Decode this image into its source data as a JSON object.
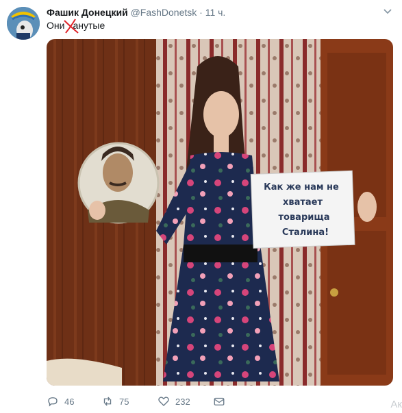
{
  "tweet": {
    "name": "Фашик Донецкий",
    "handle": "@FashDonetsk",
    "time": "· 11 ч.",
    "text": "Они",
    "text_rest": "анутые",
    "photo": {
      "sign_lines": [
        "Как же нам не",
        "хватает",
        "товарища",
        "Сталина!"
      ]
    },
    "actions": {
      "replies": "46",
      "retweets": "75",
      "likes": "232"
    },
    "truncated_right": "Ак"
  },
  "colors": {
    "muted": "#657786",
    "strike": "#e0242a",
    "dress": "#1d2a4f"
  }
}
